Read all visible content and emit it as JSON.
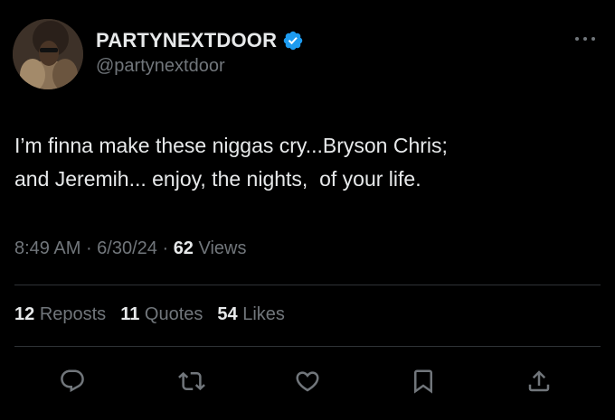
{
  "author": {
    "display_name": "PARTYNEXTDOOR",
    "handle": "@partynextdoor",
    "verified": true
  },
  "tweet": {
    "text": "I’m finna make these niggas cry...Bryson Chris;\nand Jeremih... enjoy, the nights,  of your life.",
    "time": "8:49 AM",
    "date": "6/30/24",
    "views_count": "62",
    "views_label": "Views",
    "separator": " · "
  },
  "stats": {
    "reposts_count": "12",
    "reposts_label": "Reposts",
    "quotes_count": "11",
    "quotes_label": "Quotes",
    "likes_count": "54",
    "likes_label": "Likes"
  },
  "icons": {
    "verified": "verified-badge-icon",
    "more": "more-options-icon",
    "reply": "reply-icon",
    "repost": "repost-icon",
    "like": "like-icon",
    "bookmark": "bookmark-icon",
    "share": "share-icon"
  },
  "colors": {
    "background": "#000000",
    "primary_text": "#e7e9ea",
    "secondary_text": "#71767b",
    "verified_blue": "#1d9bf0",
    "divider": "#2f3336"
  }
}
